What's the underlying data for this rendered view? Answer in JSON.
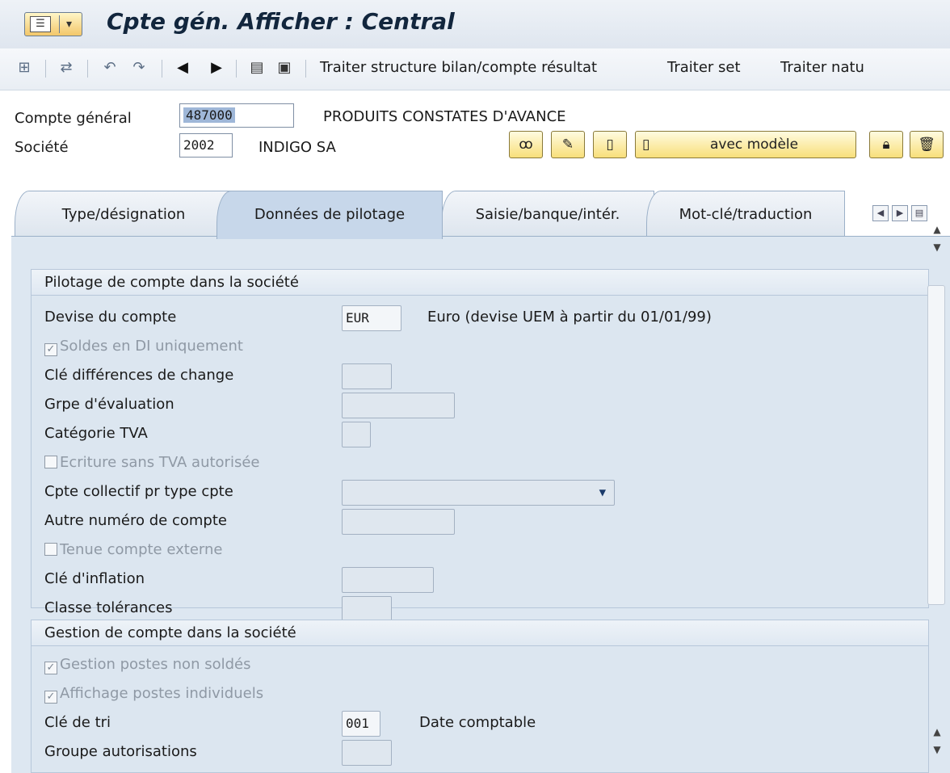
{
  "window": {
    "title": "Cpte gén. Afficher : Central"
  },
  "toolbar": {
    "icons": [
      "other-object-icon",
      "switch-icon",
      "back-nav-icon",
      "forward-nav-icon",
      "previous-arrow-icon",
      "next-arrow-icon",
      "display-table-icon",
      "document-icon"
    ],
    "items": [
      {
        "label": "Traiter structure bilan/compte résultat"
      },
      {
        "label": "Traiter set"
      },
      {
        "label": "Traiter natu"
      }
    ]
  },
  "header": {
    "account_label": "Compte général",
    "account_value": "487000",
    "account_desc": "PRODUITS CONSTATES D'AVANCE",
    "company_label": "Société",
    "company_value": "2002",
    "company_desc": "INDIGO SA",
    "with_template_label": "avec modèle"
  },
  "tabs": [
    {
      "label": "Type/désignation",
      "active": false
    },
    {
      "label": "Données de pilotage",
      "active": true
    },
    {
      "label": "Saisie/banque/intér.",
      "active": false
    },
    {
      "label": "Mot-clé/traduction",
      "active": false
    }
  ],
  "group_control": {
    "title": "Pilotage de compte dans la société",
    "currency_label": "Devise du compte",
    "currency_value": "EUR",
    "currency_desc": "Euro (devise UEM à partir du 01/01/99)",
    "balances_local_label": "Soldes en DI uniquement",
    "balances_local_checked": true,
    "exchange_diff_label": "Clé différences de change",
    "valuation_group_label": "Grpe d'évaluation",
    "tax_category_label": "Catégorie TVA",
    "posting_without_tax_label": "Ecriture sans TVA autorisée",
    "posting_without_tax_checked": false,
    "recon_account_label": "Cpte collectif pr type cpte",
    "alt_account_label": "Autre numéro de compte",
    "external_mgmt_label": "Tenue compte externe",
    "external_mgmt_checked": false,
    "inflation_key_label": "Clé d'inflation",
    "tolerance_group_label": "Classe tolérances"
  },
  "group_management": {
    "title": "Gestion de compte dans la société",
    "open_items_label": "Gestion postes non soldés",
    "open_items_checked": true,
    "line_items_label": "Affichage postes individuels",
    "line_items_checked": true,
    "sort_key_label": "Clé de tri",
    "sort_key_value": "001",
    "sort_key_desc": "Date comptable",
    "auth_group_label": "Groupe autorisations"
  },
  "colors": {
    "accent": "#f8df7a",
    "panel": "#dde7f1",
    "title_text": "#12263d"
  }
}
